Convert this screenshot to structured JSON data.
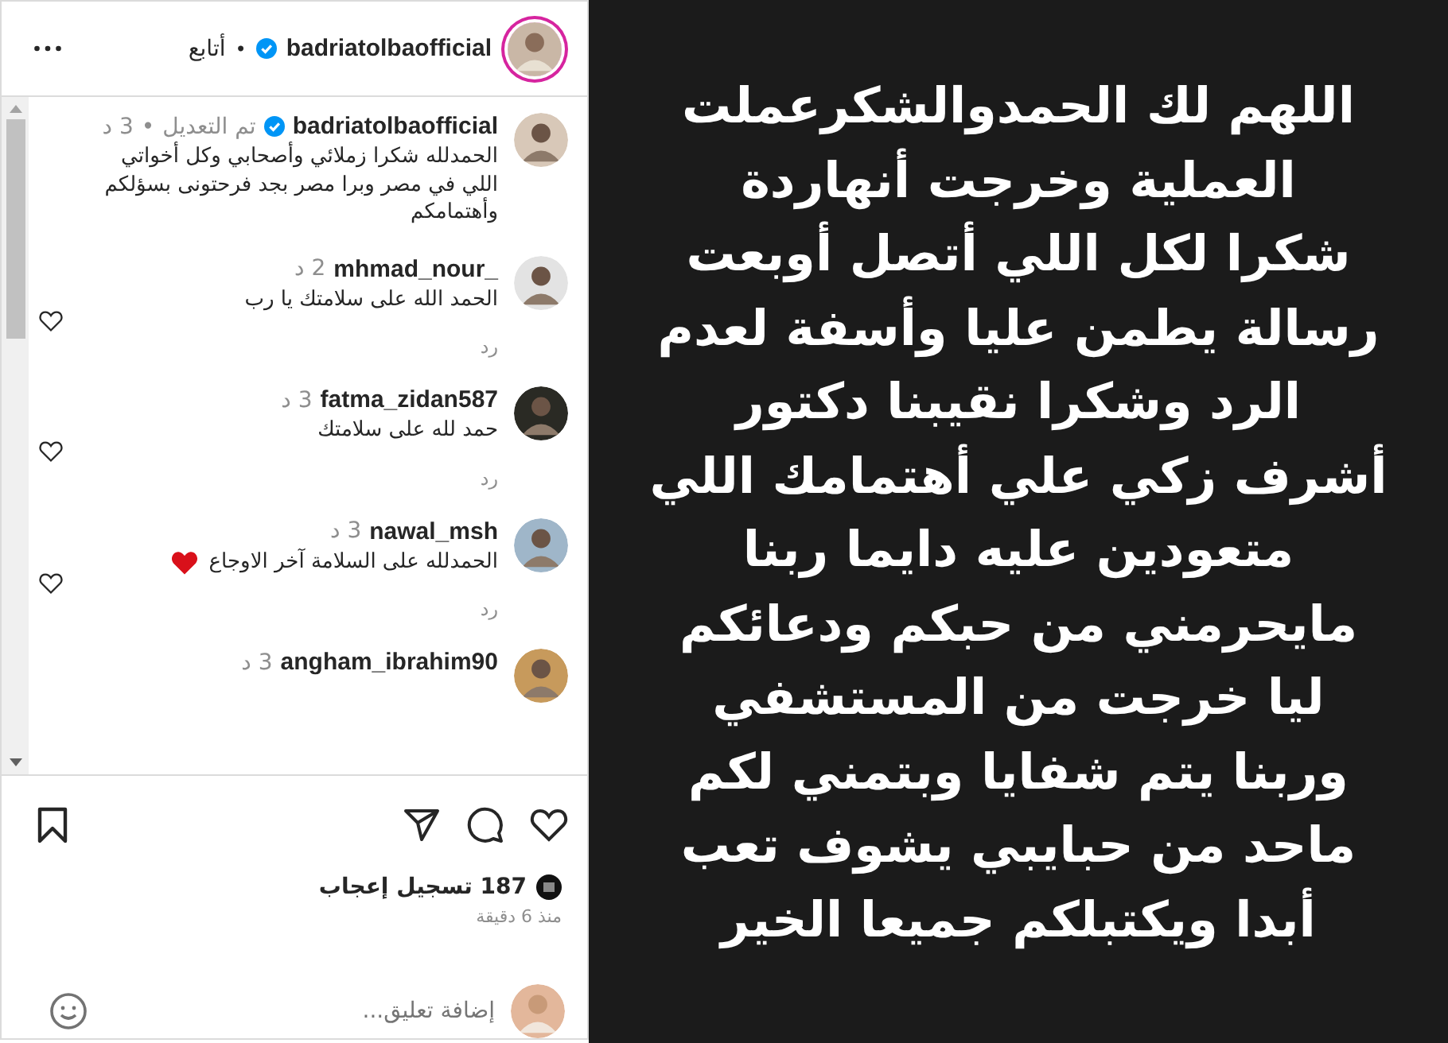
{
  "header": {
    "username": "badriatolbaofficial",
    "verified": true,
    "follow": "أتابع",
    "separator": "•"
  },
  "comments": [
    {
      "username": "badriatolbaofficial",
      "verified": true,
      "edited": "تم التعديل",
      "separator": "•",
      "time": "3 د",
      "text": "الحمدلله شكرا زملائي وأصحابي وكل أخواتي اللي في مصر وبرا مصر بجد فرحتونى بسؤلكم وأهتمامكم",
      "likeable": false
    },
    {
      "username": "mhmad_nour_",
      "verified": false,
      "time": "2 د",
      "text": "الحمد الله على سلامتك يا رب",
      "reply": "رد",
      "likeable": true
    },
    {
      "username": "fatma_zidan587",
      "verified": false,
      "time": "3 د",
      "text": "حمد لله على سلامتك",
      "reply": "رد",
      "likeable": true
    },
    {
      "username": "nawal_msh",
      "verified": false,
      "time": "3 د",
      "text": "الحمدلله على السلامة آخر الاوجاع",
      "reply": "رد",
      "heart_emoji": true,
      "likeable": true
    },
    {
      "username": "angham_ibrahim90",
      "verified": false,
      "time": "3 د",
      "likeable": false
    }
  ],
  "likes": "187 تسجيل إعجاب",
  "posted": "منذ 6 دقيقة",
  "add_comment": {
    "placeholder": "إضافة تعليق..."
  },
  "post_text": [
    "اللهم لك الحمدوالشكرعملت",
    "العملية وخرجت أنهاردة",
    "شكرا لكل اللي أتصل أوبعت",
    "رسالة يطمن عليا وأسفة لعدم",
    "الرد وشكرا نقيبنا دكتور",
    "أشرف زكي علي أهتمامك اللي",
    "متعودين عليه دايما ربنا",
    "مايحرمني من حبكم ودعائكم",
    "ليا خرجت من المستشفي",
    "وربنا يتم شفايا وبتمني لكم",
    "ماحد من حبايبي يشوف تعب",
    "أبدا ويكتبلكم جميعا الخير"
  ]
}
